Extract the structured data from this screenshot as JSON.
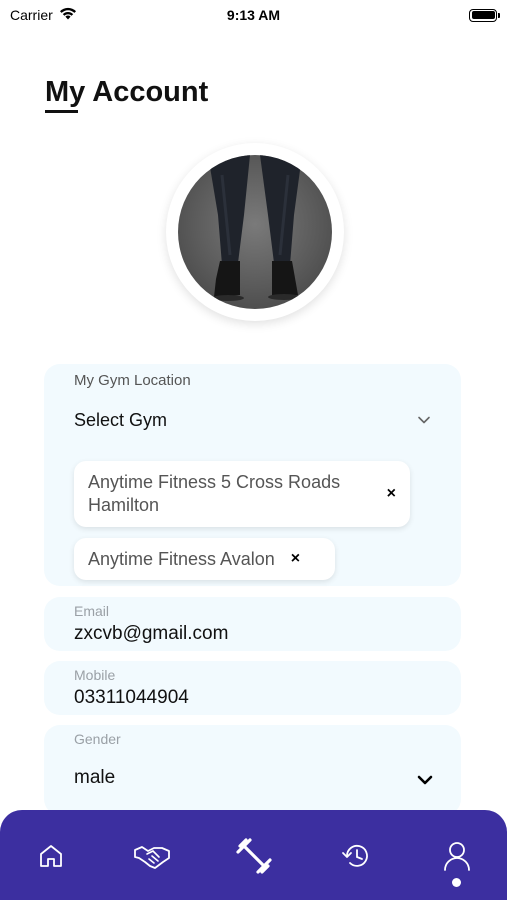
{
  "status_bar": {
    "carrier": "Carrier",
    "time": "9:13 AM"
  },
  "header": {
    "title": "My Account"
  },
  "gym": {
    "label": "My Gym Location",
    "select_value": "Select Gym",
    "chips": [
      {
        "label": "Anytime Fitness 5 Cross Roads Hamilton",
        "close": "×"
      },
      {
        "label": "Anytime Fitness Avalon",
        "close": "×"
      }
    ]
  },
  "email": {
    "label": "Email",
    "value": "zxcvb@gmail.com"
  },
  "mobile": {
    "label": "Mobile",
    "value": "03311044904"
  },
  "gender": {
    "label": "Gender",
    "value": "male"
  },
  "bottom_nav": {
    "items": [
      "home-icon",
      "handshake-icon",
      "dumbbell-icon",
      "history-icon",
      "profile-icon"
    ],
    "active": "profile-icon"
  },
  "colors": {
    "nav_background": "#3c2fa0",
    "card_background": "#f2fafe"
  }
}
